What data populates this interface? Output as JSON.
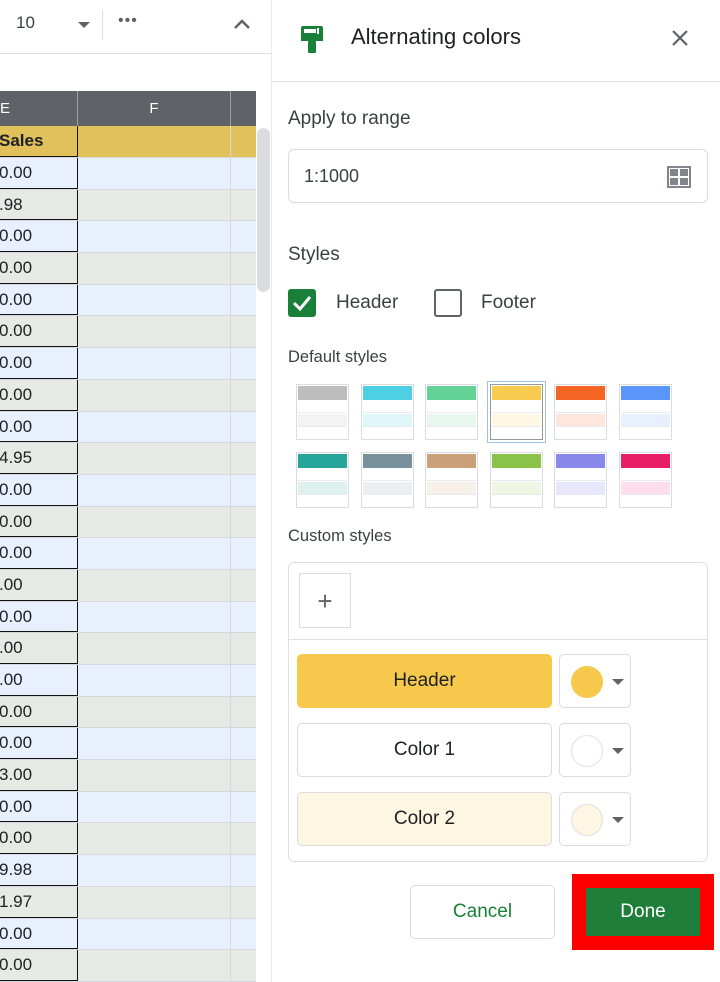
{
  "sheet": {
    "toolbar": {
      "font_size": "10",
      "more_label": "•••"
    },
    "columns": [
      "E",
      "F",
      ""
    ],
    "header_cell": "Sales",
    "e_values": [
      "0.00",
      ".98",
      "0.00",
      "0.00",
      "0.00",
      "0.00",
      "0.00",
      "0.00",
      "0.00",
      "4.95",
      "0.00",
      "0.00",
      "0.00",
      ".00",
      "0.00",
      ".00",
      ".00",
      "0.00",
      "0.00",
      "3.00",
      "0.00",
      "0.00",
      "9.98",
      "1.97",
      "0.00",
      "0.00"
    ],
    "colors": {
      "header_fill": "#e1c15a",
      "row_even": "#e8f0fe",
      "row_odd": "#e6e9e4",
      "column_header_bg": "#5f6368"
    }
  },
  "panel": {
    "title": "Alternating colors",
    "apply_to_range_label": "Apply to range",
    "range_value": "1:1000",
    "styles_label": "Styles",
    "header_checkbox": {
      "label": "Header",
      "checked": true
    },
    "footer_checkbox": {
      "label": "Footer",
      "checked": false
    },
    "default_styles_label": "Default styles",
    "default_styles": [
      {
        "name": "gray",
        "header": "#bdbdbd",
        "alt": "#f3f3f3",
        "selected": false
      },
      {
        "name": "cyan",
        "header": "#4dd0e1",
        "alt": "#e0f7fa",
        "selected": false
      },
      {
        "name": "green",
        "header": "#63d297",
        "alt": "#e7f9ef",
        "selected": false
      },
      {
        "name": "yellow",
        "header": "#f7cb4d",
        "alt": "#fef8e3",
        "selected": true
      },
      {
        "name": "orange",
        "header": "#f46524",
        "alt": "#ffe6dd",
        "selected": false
      },
      {
        "name": "blue",
        "header": "#5b95f9",
        "alt": "#e8f0fe",
        "selected": false
      },
      {
        "name": "teal",
        "header": "#26a69a",
        "alt": "#ddf2f0",
        "selected": false
      },
      {
        "name": "slate",
        "header": "#78909c",
        "alt": "#ebeff1",
        "selected": false
      },
      {
        "name": "tan",
        "header": "#c9a077",
        "alt": "#f8f1ea",
        "selected": false
      },
      {
        "name": "lime",
        "header": "#8bc34a",
        "alt": "#eef7e3",
        "selected": false
      },
      {
        "name": "lavender",
        "header": "#8989eb",
        "alt": "#e8e7fc",
        "selected": false
      },
      {
        "name": "pink",
        "header": "#e91d63",
        "alt": "#fddeea",
        "selected": false
      }
    ],
    "custom_styles_label": "Custom styles",
    "add_label": "+",
    "custom_rows": [
      {
        "label": "Header",
        "color": "#f6c94d"
      },
      {
        "label": "Color 1",
        "color": "#ffffff"
      },
      {
        "label": "Color 2",
        "color": "#fdf6e2"
      }
    ],
    "cancel_label": "Cancel",
    "done_label": "Done",
    "accent": "#188038",
    "highlight_box": "#ff0000"
  }
}
